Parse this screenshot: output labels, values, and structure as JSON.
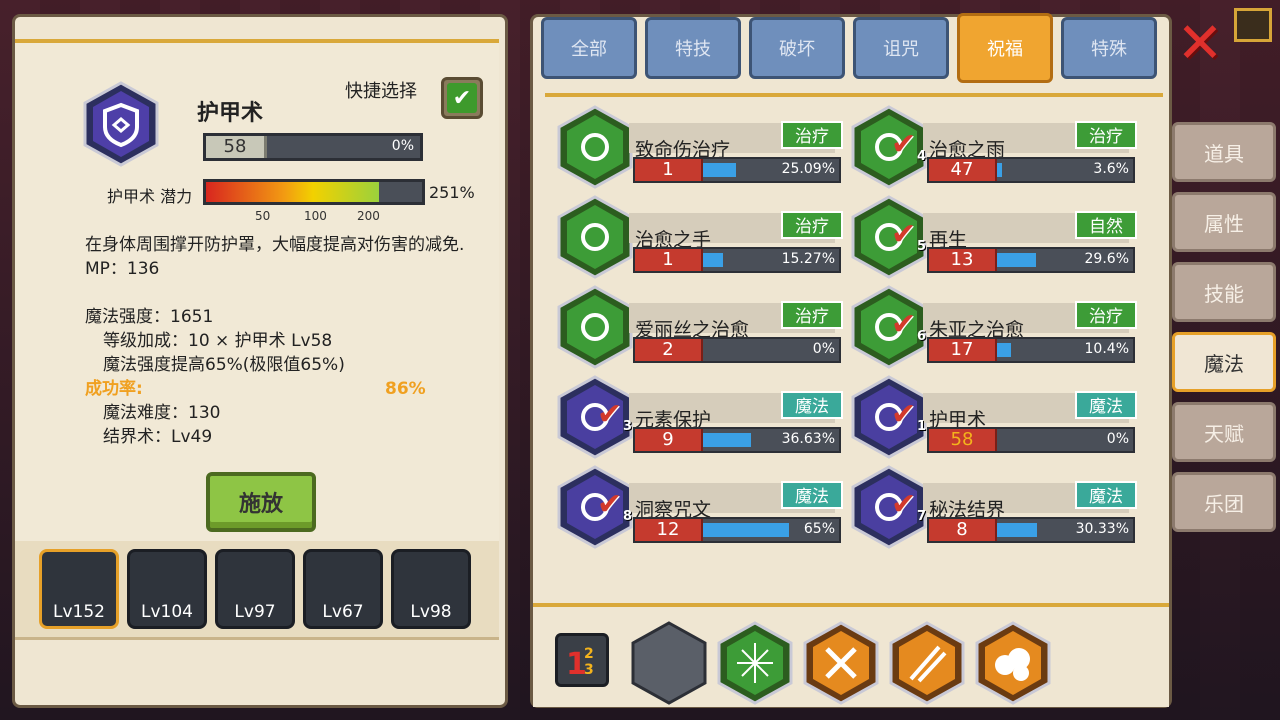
{
  "skill_detail": {
    "title": "护甲术",
    "quick_select_label": "快捷选择",
    "level": "58",
    "level_progress": "0%",
    "potential_label": "护甲术 潜力",
    "potential_value": "251%",
    "potential_fraction": 0.8,
    "potential_ticks": [
      "50",
      "100",
      "200"
    ],
    "description": "在身体周围撑开防护罩，大幅度提高对伤害的减免. MP：136",
    "stats": {
      "magic_power": "魔法强度：1651",
      "level_bonus": "等级加成：10 × 护甲术 Lv58",
      "power_up": "魔法强度提高65%(极限值65%)",
      "success_label": "成功率:",
      "success_value": "86%",
      "difficulty": "魔法难度：130",
      "barrier": "结界术：Lv49"
    },
    "cast_label": "施放"
  },
  "party_slots": [
    {
      "label": "Lv152",
      "active": true
    },
    {
      "label": "Lv104",
      "active": false
    },
    {
      "label": "Lv97",
      "active": false
    },
    {
      "label": "Lv67",
      "active": false
    },
    {
      "label": "Lv98",
      "active": false
    }
  ],
  "tabs": [
    "全部",
    "特技",
    "破坏",
    "诅咒",
    "祝福",
    "特殊"
  ],
  "active_tab": "祝福",
  "skills": [
    {
      "name": "致命伤治疗",
      "tag": "治疗",
      "level": "1",
      "pct": "25.09%",
      "fill": 0.2509,
      "color": "#3d9c37",
      "check": null
    },
    {
      "name": "治愈之雨",
      "tag": "治疗",
      "level": "47",
      "pct": "3.6%",
      "fill": 0.036,
      "color": "#3d9c37",
      "check": "4"
    },
    {
      "name": "治愈之手",
      "tag": "治疗",
      "level": "1",
      "pct": "15.27%",
      "fill": 0.1527,
      "color": "#3d9c37",
      "check": null
    },
    {
      "name": "再生",
      "tag": "自然",
      "level": "13",
      "pct": "29.6%",
      "fill": 0.296,
      "color": "#3d9c37",
      "check": "5"
    },
    {
      "name": "爱丽丝之治愈",
      "tag": "治疗",
      "level": "2",
      "pct": "0%",
      "fill": 0,
      "color": "#3d9c37",
      "check": null
    },
    {
      "name": "朱亚之治愈",
      "tag": "治疗",
      "level": "17",
      "pct": "10.4%",
      "fill": 0.104,
      "color": "#3d9c37",
      "check": "6"
    },
    {
      "name": "元素保护",
      "tag": "魔法",
      "level": "9",
      "pct": "36.63%",
      "fill": 0.3663,
      "color": "#4a3fa0",
      "check": "3"
    },
    {
      "name": "护甲术",
      "tag": "魔法",
      "level": "58",
      "pct": "0%",
      "fill": 0,
      "color": "#4a3fa0",
      "check": "1",
      "gold": true
    },
    {
      "name": "洞察咒文",
      "tag": "魔法",
      "level": "12",
      "pct": "65%",
      "fill": 0.65,
      "color": "#4a3fa0",
      "check": "8"
    },
    {
      "name": "秘法结界",
      "tag": "魔法",
      "level": "8",
      "pct": "30.33%",
      "fill": 0.3033,
      "color": "#4a3fa0",
      "check": "7"
    }
  ],
  "side_nav": [
    "道具",
    "属性",
    "技能",
    "魔法",
    "天赋",
    "乐团"
  ],
  "side_nav_active": "魔法",
  "quick_bar_icons": [
    "order-123-icon",
    "empty-slot-icon",
    "green-burst-icon",
    "orange-spin-icon",
    "orange-dash-icon",
    "orange-cloud-icon"
  ]
}
